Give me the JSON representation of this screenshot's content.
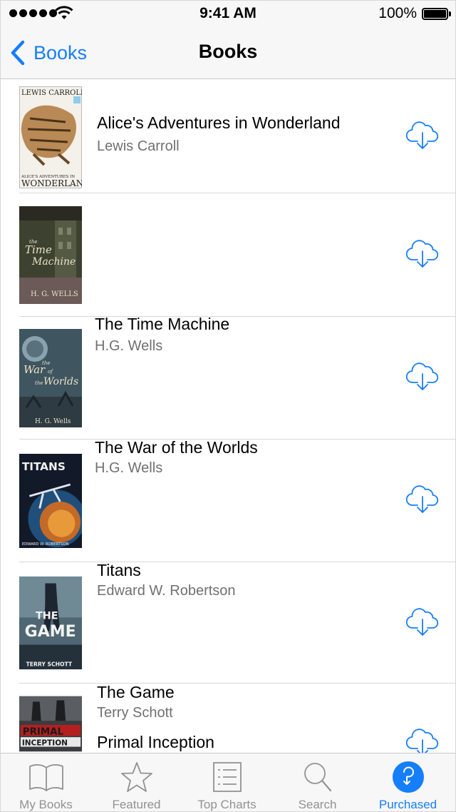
{
  "status_bar": {
    "time": "9:41 AM",
    "battery": "100%"
  },
  "nav": {
    "back_label": "Books",
    "title": "Books"
  },
  "books": [
    {
      "title": "Alice's Adventures in Wonderland",
      "author": "Lewis Carroll",
      "cover_text_top": "LEWIS CARROLL",
      "cover_text_bottom": "ALICE'S ADVENTURES IN WONDERLAND"
    },
    {
      "title": "The Time Machine",
      "author": "H.G. Wells",
      "cover_text_top": "the Time Machine",
      "cover_text_bottom": "H. G. WELLS"
    },
    {
      "title": "The War of the Worlds",
      "author": "H.G. Wells",
      "cover_text_top": "the War of the Worlds",
      "cover_text_bottom": "H. G. Wells"
    },
    {
      "title": "Titans",
      "author": "Edward W. Robertson",
      "cover_text_top": "TITANS",
      "cover_text_bottom": "EDWARD W. ROBERTSON"
    },
    {
      "title": "The Game",
      "author": "Terry Schott",
      "cover_text_top": "THE GAME",
      "cover_text_bottom": "TERRY SCHOTT"
    },
    {
      "title": "Primal Inception",
      "author": "",
      "cover_text_top": "PRIMAL INCEPTION",
      "cover_text_bottom": ""
    }
  ],
  "tabs": [
    {
      "label": "My Books",
      "icon": "open-book-icon"
    },
    {
      "label": "Featured",
      "icon": "star-icon"
    },
    {
      "label": "Top Charts",
      "icon": "list-icon"
    },
    {
      "label": "Search",
      "icon": "search-icon"
    },
    {
      "label": "Purchased",
      "icon": "purchased-icon",
      "active": true
    }
  ],
  "colors": {
    "accent": "#157efb",
    "inactive_tab": "#929292",
    "secondary_text": "#707070"
  }
}
